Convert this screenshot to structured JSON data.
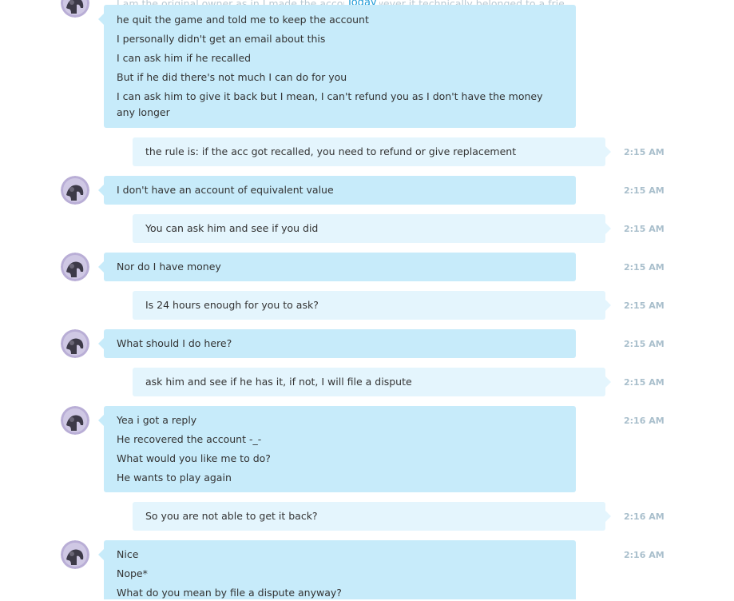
{
  "day_divider": "Today",
  "top_partial_text": "I am the original owner as in I made the account however it technically belonged to a friend,",
  "messages": [
    {
      "direction": "in",
      "time": "",
      "lines": [
        "he quit the game and told me to keep the account",
        "I personally didn't get an email about this",
        "I can ask him if he recalled",
        "But if he did there's not much I can do for you",
        "I can ask him to give it back but I mean, I can't refund you as I don't have the money any longer"
      ]
    },
    {
      "direction": "out",
      "time": "2:15 AM",
      "lines": [
        "the rule is: if the acc got recalled, you need to refund or give replacement"
      ]
    },
    {
      "direction": "in",
      "time": "2:15 AM",
      "lines": [
        "I don't have an account of equivalent value"
      ]
    },
    {
      "direction": "out",
      "time": "2:15 AM",
      "lines": [
        "You can ask him and see if you did"
      ]
    },
    {
      "direction": "in",
      "time": "2:15 AM",
      "lines": [
        "Nor do I have money"
      ]
    },
    {
      "direction": "out",
      "time": "2:15 AM",
      "lines": [
        "Is 24 hours enough for you to ask?"
      ]
    },
    {
      "direction": "in",
      "time": "2:15 AM",
      "lines": [
        "What should I do here?"
      ]
    },
    {
      "direction": "out",
      "time": "2:15 AM",
      "lines": [
        "ask him and see if he has it, if not, I will file a dispute"
      ]
    },
    {
      "direction": "in",
      "time": "2:16 AM",
      "lines": [
        "Yea i got a reply",
        "He recovered the account -_-",
        "What would you like me to do?",
        "He wants to play again"
      ]
    },
    {
      "direction": "out",
      "time": "2:16 AM",
      "lines": [
        "So you are not able to get it back?"
      ]
    },
    {
      "direction": "in",
      "time": "2:16 AM",
      "lines": [
        "Nice",
        "Nope*",
        "What do you mean by file a dispute anyway?"
      ]
    }
  ],
  "colors": {
    "incoming_bubble": "#c7ebfa",
    "outgoing_bubble": "#e4f5fd",
    "timestamp": "#a9bfcc",
    "day_divider": "#1d9ad6"
  }
}
